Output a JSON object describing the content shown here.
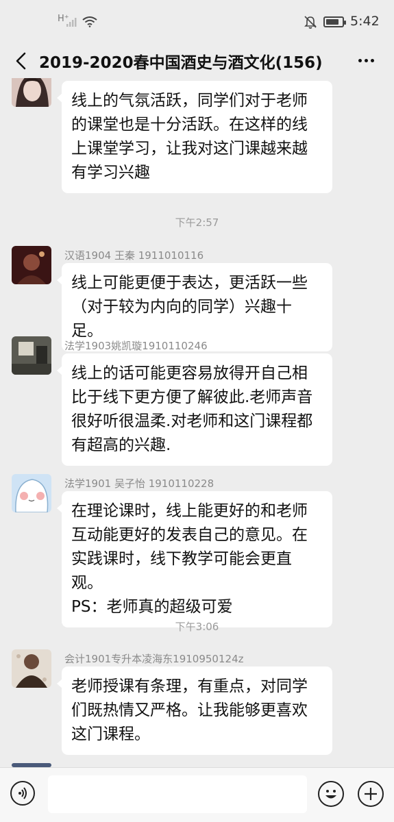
{
  "status_bar": {
    "network_label": "H⁺",
    "time": "5:42",
    "battery_level": 0.8
  },
  "header": {
    "title": "2019-2020春中国酒史与酒文化(156)",
    "back_icon": "chevron-left-icon",
    "more_icon": "more-dots-icon"
  },
  "messages": [
    {
      "sender": "",
      "lines": [
        "线上的气氛活跃，同学们对于老师",
        "的课堂也是十分活跃。在这样的线",
        "上课堂学习，让我对这门课越来越",
        "有学习兴趣"
      ],
      "avatar_colors": [
        "#c9a9a0",
        "#3a2a28",
        "#e8d4cc"
      ]
    },
    {
      "sender": "汉语1904  王秦 1911010116",
      "lines": [
        "线上可能更便于表达，更活跃一些",
        "（对于较为内向的同学）兴趣十足。"
      ],
      "avatar_colors": [
        "#5a1f1f",
        "#2a0f0f",
        "#c49a7a"
      ]
    },
    {
      "sender": "法学1903姚凯璇1910110246",
      "lines": [
        "线上的话可能更容易放得开自己相",
        "比于线下更方便了解彼此.老师声音",
        "很好听很温柔.对老师和这门课程都",
        "有超高的兴趣."
      ],
      "avatar_colors": [
        "#4a4a44",
        "#7a7a70",
        "#d8d4c8"
      ]
    },
    {
      "sender": "法学1901 吴子怡 1910110228",
      "lines": [
        "在理论课时，线上能更好的和老师",
        "互动能更好的发表自己的意见。在",
        "实践课时，线下教学可能会更直观。",
        "PS：老师真的超级可爱"
      ],
      "avatar_colors": [
        "#cfe3f5",
        "#f4b6b6",
        "#ffffff"
      ]
    },
    {
      "sender": "会计1901专升本凌海东1910950124z",
      "lines": [
        "老师授课有条理，有重点，对同学",
        "们既热情又严格。让我能够更喜欢",
        "这门课程。"
      ],
      "avatar_colors": [
        "#6a4a3a",
        "#d8c8b8",
        "#3a2a20"
      ]
    }
  ],
  "timestamps": [
    "下午2:57",
    "下午3:06"
  ],
  "input_bar": {
    "placeholder": "",
    "voice_icon": "voice-icon",
    "emoji_icon": "emoji-icon",
    "plus_icon": "plus-icon"
  }
}
